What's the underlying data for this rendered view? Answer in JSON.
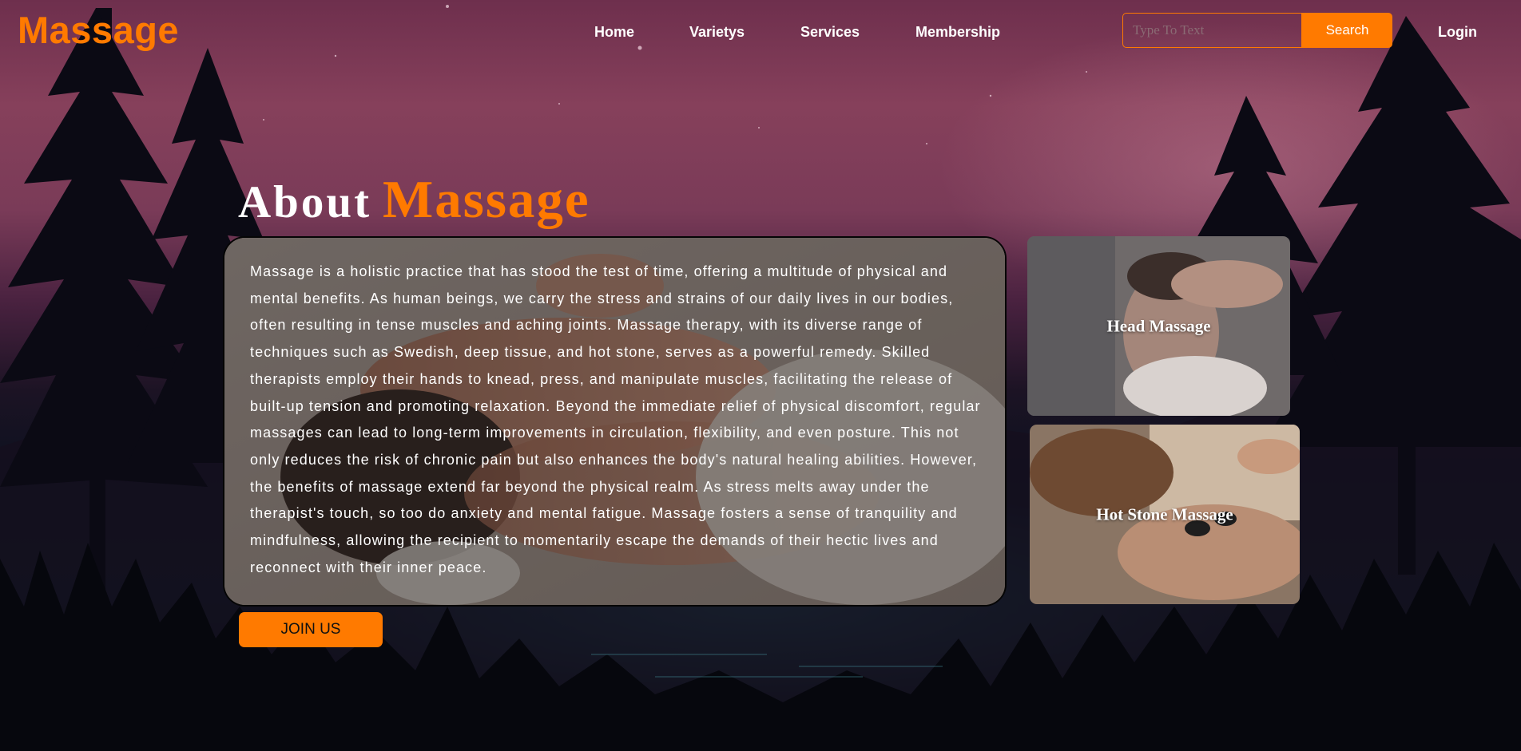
{
  "header": {
    "brand": "Massage",
    "nav": {
      "home": "Home",
      "varietys": "Varietys",
      "services": "Services",
      "membership": "Membership"
    },
    "search": {
      "placeholder": "Type To Text",
      "button_label": "Search"
    },
    "login_label": "Login"
  },
  "about": {
    "title_word1": "About",
    "title_word2": "Massage",
    "paragraph": "Massage is a holistic practice that has stood the test of time, offering a multitude of physical and mental benefits. As human beings, we carry the stress and strains of our daily lives in our bodies, often resulting in tense muscles and aching joints. Massage therapy, with its diverse range of techniques such as Swedish, deep tissue, and hot stone, serves as a powerful remedy. Skilled therapists employ their hands to knead, press, and manipulate muscles, facilitating the release of built-up tension and promoting relaxation. Beyond the immediate relief of physical discomfort, regular massages can lead to long-term improvements in circulation, flexibility, and even posture. This not only reduces the risk of chronic pain but also enhances the body's natural healing abilities. However, the benefits of massage extend far beyond the physical realm. As stress melts away under the therapist's touch, so too do anxiety and mental fatigue. Massage fosters a sense of tranquility and mindfulness, allowing the recipient to momentarily escape the demands of their hectic lives and reconnect with their inner peace.",
    "join_label": "JOIN US"
  },
  "cards": [
    {
      "label": "Head Massage"
    },
    {
      "label": "Hot Stone Massage"
    }
  ],
  "colors": {
    "accent": "#ff7a00",
    "text": "#ffffff"
  }
}
